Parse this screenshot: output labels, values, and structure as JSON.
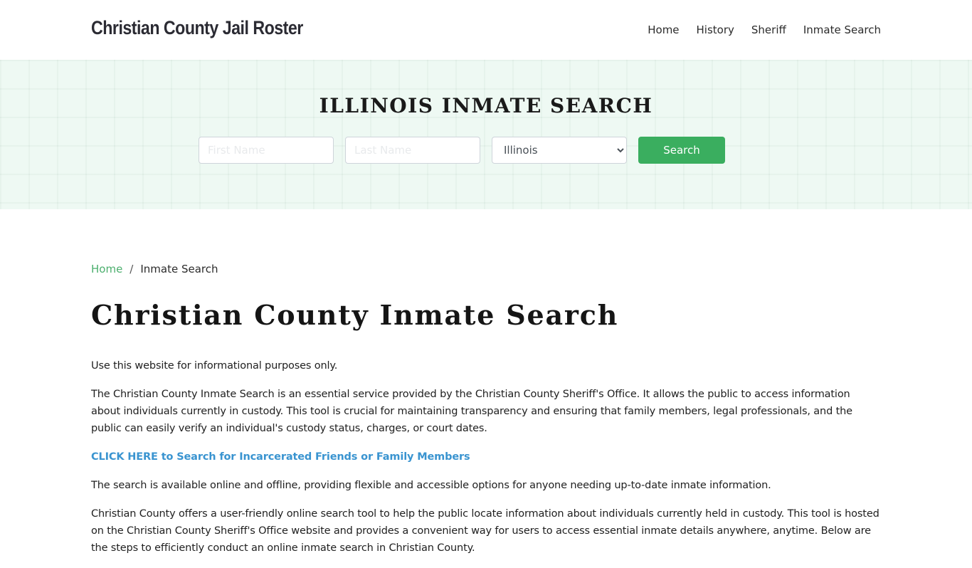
{
  "header": {
    "brand": "Christian County Jail Roster",
    "nav": [
      {
        "label": "Home"
      },
      {
        "label": "History"
      },
      {
        "label": "Sheriff"
      },
      {
        "label": "Inmate Search"
      }
    ]
  },
  "hero": {
    "title": "ILLINOIS INMATE SEARCH",
    "first_name_placeholder": "First Name",
    "last_name_placeholder": "Last Name",
    "state_selected": "Illinois",
    "search_label": "Search",
    "accent_color": "#3aae5f"
  },
  "breadcrumb": {
    "home": "Home",
    "separator": "/",
    "current": "Inmate Search"
  },
  "main": {
    "title": "Christian County Inmate Search",
    "paragraphs": [
      "Use this website for informational purposes only.",
      "The Christian County Inmate Search is an essential service provided by the Christian County Sheriff's Office. It allows the public to access information about individuals currently in custody. This tool is crucial for maintaining transparency and ensuring that family members, legal professionals, and the public can easily verify an individual's custody status, charges, or court dates.",
      "CLICK HERE to Search for Incarcerated Friends or Family Members",
      "The search is available online and offline, providing flexible and accessible options for anyone needing up-to-date inmate information.",
      "Christian County offers a user-friendly online search tool to help the public locate information about individuals currently held in custody. This tool is hosted on the Christian County Sheriff's Office website and provides a convenient way for users to access essential inmate details anywhere, anytime. Below are the steps to efficiently conduct an online inmate search in Christian County."
    ]
  }
}
